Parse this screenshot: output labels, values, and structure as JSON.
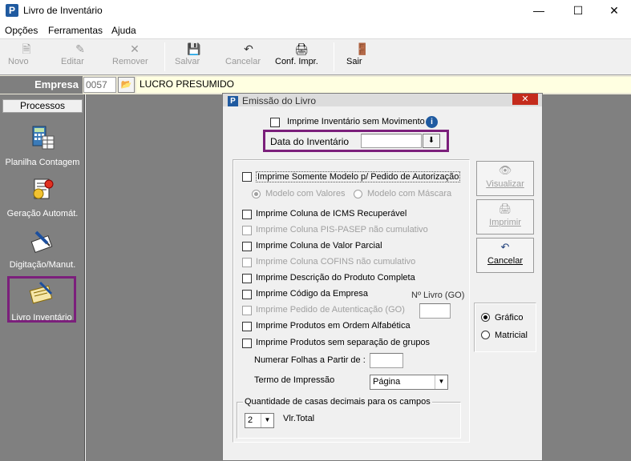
{
  "window": {
    "title": "Livro de Inventário",
    "app_icon_letter": "P",
    "controls": {
      "minimize": "—",
      "maximize": "☐",
      "close": "✕"
    }
  },
  "menu": [
    "Opções",
    "Ferramentas",
    "Ajuda"
  ],
  "toolbar": {
    "novo": "Novo",
    "editar": "Editar",
    "remover": "Remover",
    "salvar": "Salvar",
    "cancelar": "Cancelar",
    "conf_impr": "Conf. Impr.",
    "sair": "Sair"
  },
  "empresa": {
    "label": "Empresa",
    "code": "0057",
    "name": "LUCRO PRESUMIDO"
  },
  "left_panel": {
    "header": "Processos",
    "items": [
      "Planilha Contagem",
      "Geração Automát.",
      "Digitação/Manut.",
      "Livro Inventário"
    ],
    "selected": "Livro Inventário"
  },
  "dialog": {
    "title": "Emissão do Livro",
    "imprime_sem_movimento": "Imprime Inventário sem Movimento",
    "data_inventario_label": "Data do Inventário",
    "data_inventario_value": "",
    "options": [
      "Imprime Somente Modelo p/ Pedido de Autorização",
      "Imprime Coluna de ICMS Recuperável",
      "Imprime Coluna PIS-PASEP não cumulativo",
      "Imprime Coluna de Valor Parcial",
      "Imprime Coluna COFINS não cumulativo",
      "Imprime Descrição do Produto Completa",
      "Imprime Código da Empresa",
      "Imprime Pedido de Autenticação (GO)",
      "Imprime Produtos em Ordem Alfabética",
      "Imprime Produtos sem separação de grupos"
    ],
    "modelo_valores": "Modelo com Valores",
    "modelo_mascara": "Modelo com Máscara",
    "n_livro_label": "Nº Livro (GO)",
    "n_livro_value": "",
    "numerar_folhas_label": "Numerar Folhas a Partir de :",
    "numerar_folhas_value": "",
    "termo_label": "Termo de Impressão",
    "termo_value": "Página",
    "decimais_legend": "Quantidade de casas decimais para os campos",
    "decimais_value": "2",
    "vlr_total_label": "Vlr.Total",
    "buttons": {
      "visualizar": "Visualizar",
      "imprimir": "Imprimir",
      "cancelar": "Cancelar"
    },
    "output": {
      "grafico": "Gráfico",
      "matricial": "Matricial",
      "selected": "Gráfico"
    }
  }
}
